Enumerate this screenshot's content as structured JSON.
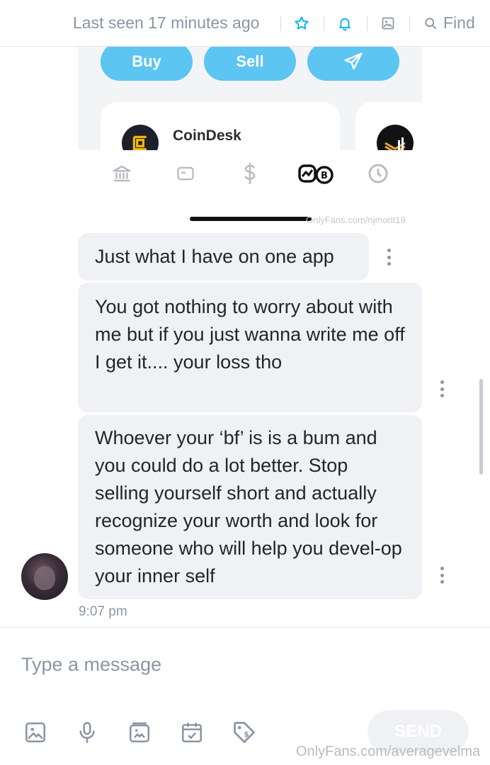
{
  "header": {
    "last_seen": "Last seen 17 minutes ago",
    "find_label": "Find",
    "icons": [
      "star-icon",
      "bell-icon",
      "image-icon",
      "search-icon"
    ]
  },
  "embedded_screenshot": {
    "buy_label": "Buy",
    "sell_label": "Sell",
    "card_title": "CoinDesk",
    "nav_icons": [
      "bank-icon",
      "card-icon",
      "dollar-icon",
      "crypto-icon",
      "clock-icon"
    ]
  },
  "watermark_top": "OnlyFans.com/njmont19",
  "messages": [
    {
      "text": "Just what I have on one app"
    },
    {
      "text": "You got nothing to worry about with me but if you just wanna write me off I get it.... your loss tho"
    },
    {
      "text": "Whoever your ‘bf’ is is a bum and you could do a lot better. Stop selling yourself short and actually recognize your worth and look for someone who will help you devel-op your inner self"
    }
  ],
  "message_time": "9:07 pm",
  "composer": {
    "placeholder": "Type a message",
    "send_label": "SEND",
    "tools": [
      "image-icon",
      "microphone-icon",
      "media-vault-icon",
      "calendar-check-icon",
      "price-tag-icon"
    ]
  },
  "watermark_bottom": "OnlyFans.com/averagevelma",
  "colors": {
    "accent": "#00aff0",
    "pill_blue": "#5cc5f2",
    "muted_text": "#8a96a3",
    "bubble_bg": "#f0f1f4"
  }
}
